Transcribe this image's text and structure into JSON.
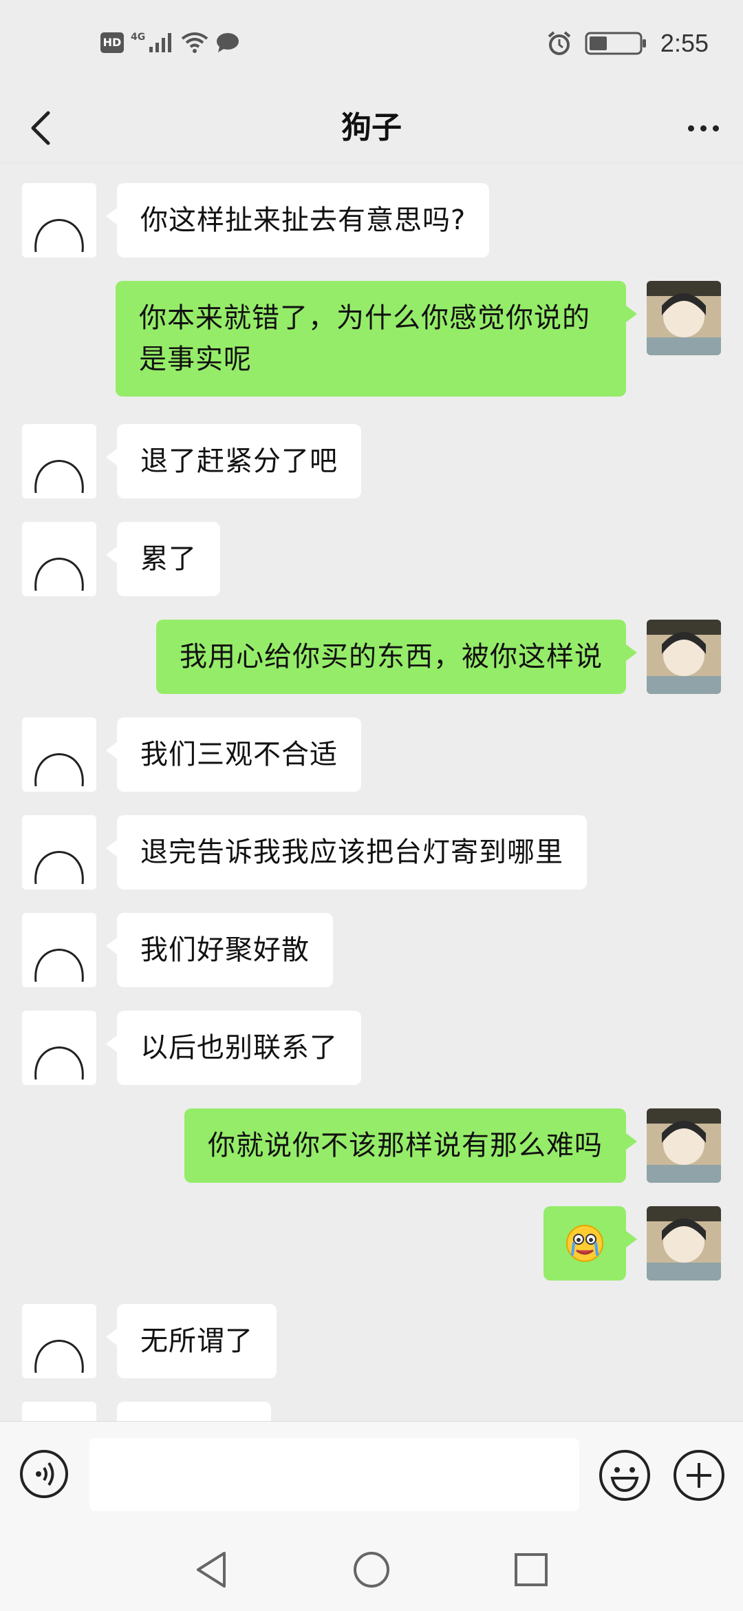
{
  "status_bar": {
    "hd": "HD",
    "net": "4G",
    "time": "2:55",
    "battery_level": 0.35
  },
  "header": {
    "title": "狗子"
  },
  "messages": [
    {
      "side": "in",
      "text": "你这样扯来扯去有意思吗?"
    },
    {
      "side": "out",
      "text": "你本来就错了，为什么你感觉你说的是事实呢"
    },
    {
      "side": "in",
      "text": "退了赶紧分了吧"
    },
    {
      "side": "in",
      "text": "累了"
    },
    {
      "side": "out",
      "text": "我用心给你买的东西，被你这样说"
    },
    {
      "side": "in",
      "text": "我们三观不合适"
    },
    {
      "side": "in",
      "text": "退完告诉我我应该把台灯寄到哪里"
    },
    {
      "side": "in",
      "text": "我们好聚好散"
    },
    {
      "side": "in",
      "text": "以后也别联系了"
    },
    {
      "side": "out",
      "text": "你就说你不该那样说有那么难吗"
    },
    {
      "side": "out",
      "emoji": "crying-laughing-face"
    },
    {
      "side": "in",
      "text": "无所谓了"
    }
  ],
  "input": {
    "value": "",
    "placeholder": ""
  },
  "colors": {
    "bubble_out": "#95ec69",
    "bubble_in": "#ffffff",
    "background": "#ededed"
  }
}
